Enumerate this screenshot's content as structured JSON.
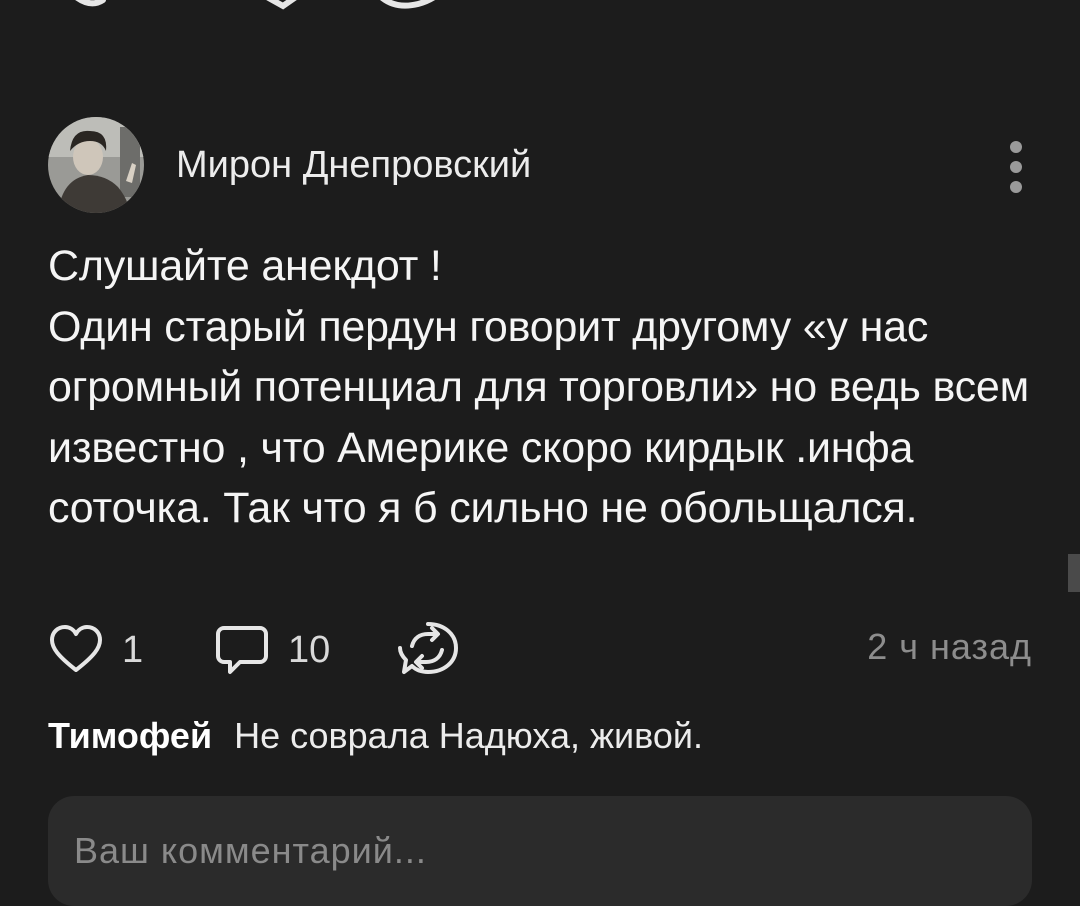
{
  "post": {
    "author": {
      "name": "Мирон Днепровский",
      "avatar_icon": "user-photo-avatar"
    },
    "text": "Слушайте анекдот !\nОдин старый пердун говорит другому «у нас огромный потенциал для торговли» но ведь всем известно , что Америке скоро кирдык .инфа соточка. Так что я б сильно не обольщался.",
    "likes": "1",
    "comments": "10",
    "time": "2 ч назад"
  },
  "icons": {
    "like": "heart-icon",
    "comment": "speech-bubble-icon",
    "share": "repost-icon",
    "more": "vertical-dots-icon"
  },
  "latest_comment": {
    "author": "Тимофей",
    "text": "Не соврала Надюха, живой."
  },
  "comment_box": {
    "placeholder": "Ваш комментарий..."
  },
  "colors": {
    "background": "#1c1c1c",
    "input_background": "#2b2b2b",
    "muted_text": "#8d8d8d"
  }
}
